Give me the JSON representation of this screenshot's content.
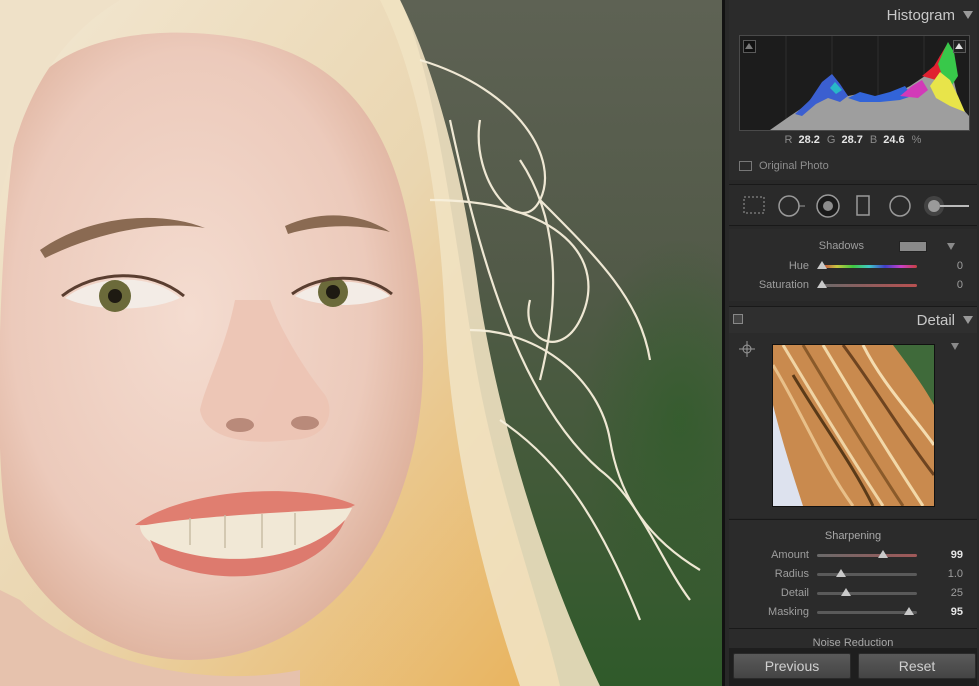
{
  "panel": {
    "histogram": {
      "title": "Histogram",
      "rgb": {
        "r_label": "R",
        "r": "28.2",
        "g_label": "G",
        "g": "28.7",
        "b_label": "B",
        "b": "24.6",
        "unit": "%"
      },
      "original_photo_label": "Original Photo"
    },
    "split_toning": {
      "shadows_label": "Shadows",
      "hue_label": "Hue",
      "hue_value": "0",
      "saturation_label": "Saturation",
      "saturation_value": "0"
    },
    "detail": {
      "title": "Detail",
      "sharpening_title": "Sharpening",
      "sliders": [
        {
          "label": "Amount",
          "value": "99",
          "fraction": 0.66,
          "active": true
        },
        {
          "label": "Radius",
          "value": "1.0",
          "fraction": 0.24,
          "active": false
        },
        {
          "label": "Detail",
          "value": "25",
          "fraction": 0.29,
          "active": false
        },
        {
          "label": "Masking",
          "value": "95",
          "fraction": 0.92,
          "active": true
        }
      ],
      "noise_reduction_title": "Noise Reduction"
    },
    "buttons": {
      "previous": "Previous",
      "reset": "Reset"
    }
  },
  "colors": {
    "panel_bg": "#2b2b2b",
    "accent_text": "#e6e6e6",
    "footer_button": "#4f4f4f"
  }
}
